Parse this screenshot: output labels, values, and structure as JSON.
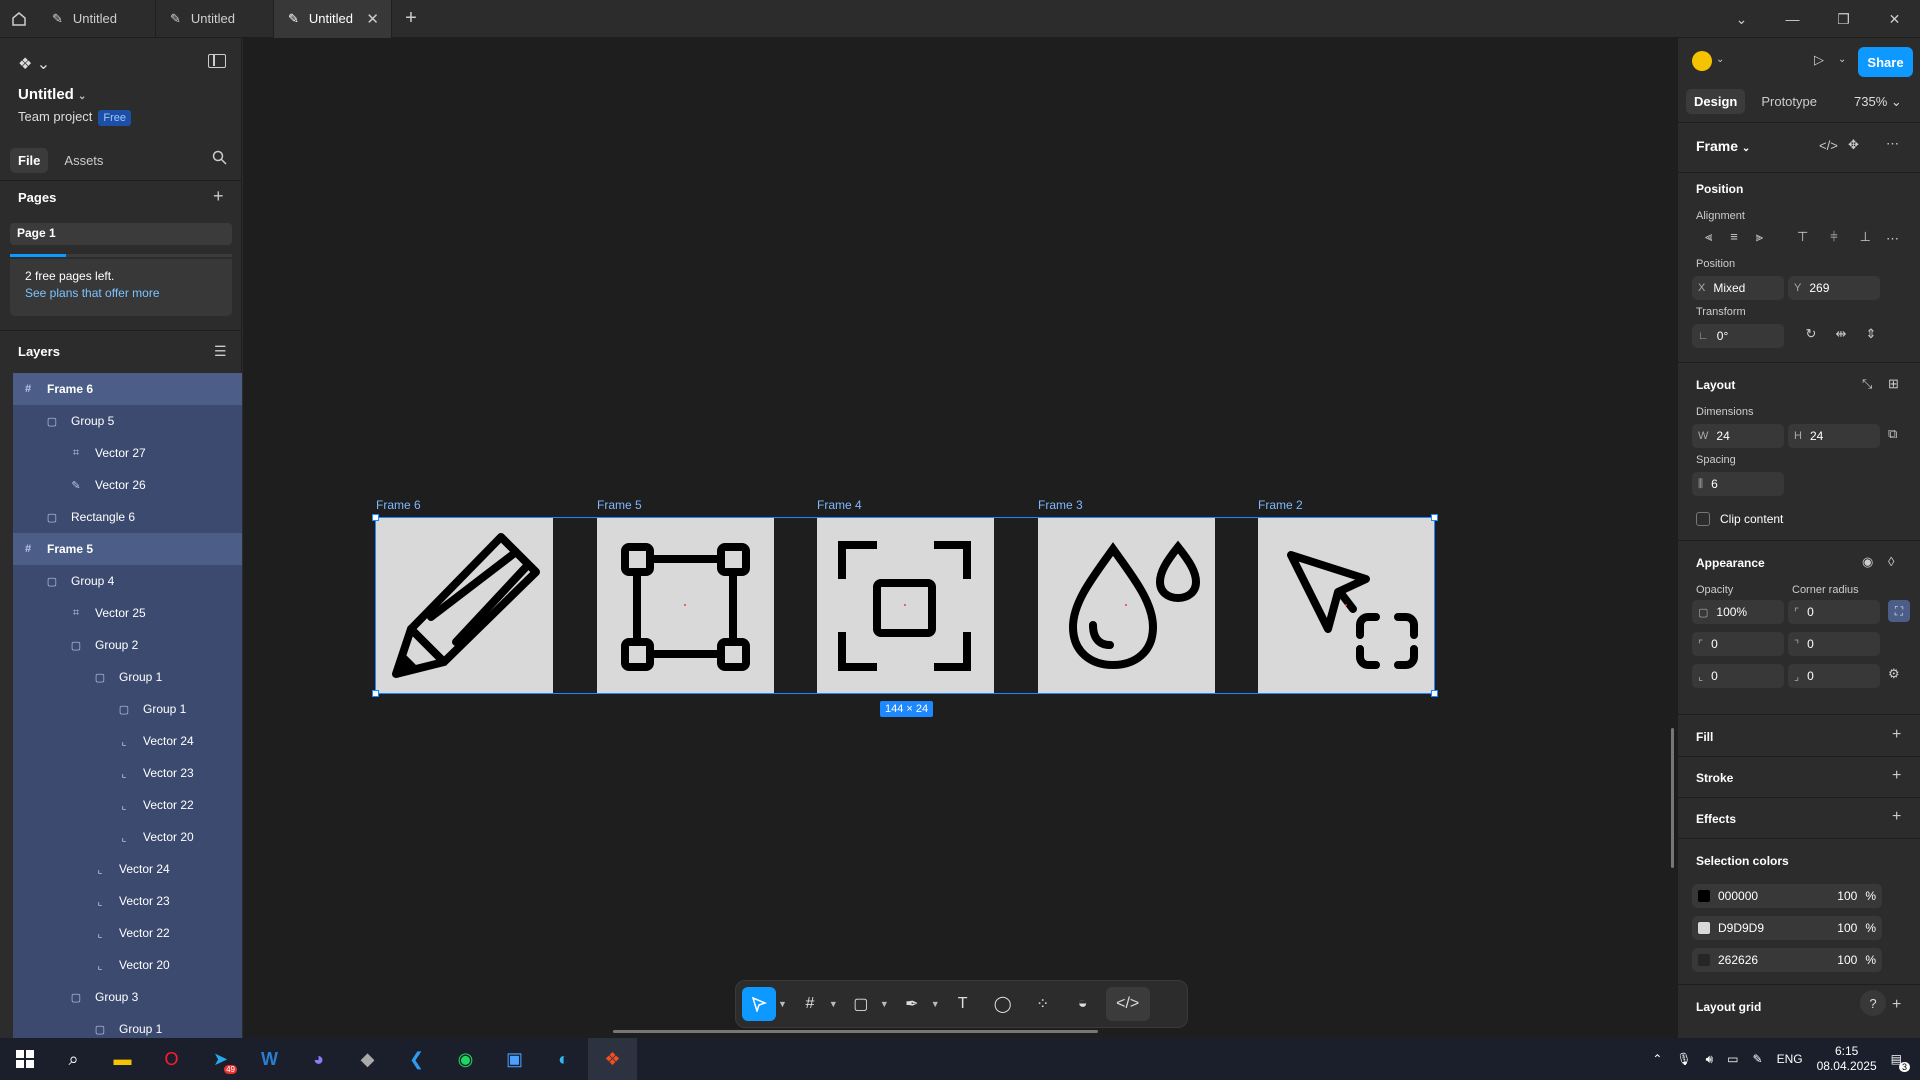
{
  "titlebar": {
    "tabs": [
      {
        "label": "Untitled",
        "active": false
      },
      {
        "label": "Untitled",
        "active": false
      },
      {
        "label": "Untitled",
        "active": true
      }
    ]
  },
  "left": {
    "project_title": "Untitled",
    "project_sub": "Team project",
    "badge": "Free",
    "tab_file": "File",
    "tab_assets": "Assets",
    "pages_header": "Pages",
    "page_name": "Page 1",
    "pages_progress": 0.25,
    "free_pages": "2 free pages left.",
    "see_plans": "See plans that offer more",
    "layers_header": "Layers",
    "layers": [
      {
        "label": "Frame 6",
        "kind": "frame",
        "depth": 0
      },
      {
        "label": "Group 5",
        "kind": "group",
        "depth": 1
      },
      {
        "label": "Vector 27",
        "kind": "vector",
        "depth": 2
      },
      {
        "label": "Vector 26",
        "kind": "pen",
        "depth": 2
      },
      {
        "label": "Rectangle 6",
        "kind": "group",
        "depth": 1
      },
      {
        "label": "Frame 5",
        "kind": "frame",
        "depth": 0
      },
      {
        "label": "Group 4",
        "kind": "group",
        "depth": 1
      },
      {
        "label": "Vector 25",
        "kind": "vector",
        "depth": 2
      },
      {
        "label": "Group 2",
        "kind": "group",
        "depth": 2
      },
      {
        "label": "Group 1",
        "kind": "group",
        "depth": 3
      },
      {
        "label": "Group 1",
        "kind": "group",
        "depth": 4
      },
      {
        "label": "Vector 24",
        "kind": "corner",
        "depth": 4
      },
      {
        "label": "Vector 23",
        "kind": "corner",
        "depth": 4
      },
      {
        "label": "Vector 22",
        "kind": "corner",
        "depth": 4
      },
      {
        "label": "Vector 20",
        "kind": "corner",
        "depth": 4
      },
      {
        "label": "Vector 24",
        "kind": "corner",
        "depth": 3
      },
      {
        "label": "Vector 23",
        "kind": "corner",
        "depth": 3
      },
      {
        "label": "Vector 22",
        "kind": "corner",
        "depth": 3
      },
      {
        "label": "Vector 20",
        "kind": "corner",
        "depth": 3
      },
      {
        "label": "Group 3",
        "kind": "group",
        "depth": 2
      },
      {
        "label": "Group 1",
        "kind": "group",
        "depth": 3
      }
    ]
  },
  "canvas": {
    "frames": [
      {
        "label": "Frame 6",
        "icon": "pencil-icon"
      },
      {
        "label": "Frame 5",
        "icon": "vector-square-icon"
      },
      {
        "label": "Frame 4",
        "icon": "focus-frame-icon"
      },
      {
        "label": "Frame 3",
        "icon": "water-drops-icon"
      },
      {
        "label": "Frame 2",
        "icon": "cursor-select-icon"
      }
    ],
    "size_badge": "144 × 24"
  },
  "right": {
    "share": "Share",
    "tab_design": "Design",
    "tab_prototype": "Prototype",
    "zoom": "735%",
    "selection_type": "Frame",
    "position_header": "Position",
    "alignment_label": "Alignment",
    "position_label": "Position",
    "x_key": "X",
    "x_val": "Mixed",
    "y_key": "Y",
    "y_val": "269",
    "transform_label": "Transform",
    "rotation": "0°",
    "layout_header": "Layout",
    "dimensions_label": "Dimensions",
    "w_key": "W",
    "w_val": "24",
    "h_key": "H",
    "h_val": "24",
    "spacing_label": "Spacing",
    "spacing_val": "6",
    "clip_content": "Clip content",
    "appearance_header": "Appearance",
    "opacity_label": "Opacity",
    "opacity_val": "100%",
    "corner_label": "Corner radius",
    "corner_val": "0",
    "corner_tl": "0",
    "corner_tr": "0",
    "corner_bl": "0",
    "corner_br": "0",
    "fill": "Fill",
    "stroke": "Stroke",
    "effects": "Effects",
    "selection_colors": "Selection colors",
    "colors": [
      {
        "hex": "000000",
        "swatch": "#000000",
        "pct": "100"
      },
      {
        "hex": "D9D9D9",
        "swatch": "#D9D9D9",
        "pct": "100"
      },
      {
        "hex": "262626",
        "swatch": "#262626",
        "pct": "100"
      }
    ],
    "pct_sign": "%",
    "layout_grid": "Layout grid"
  },
  "taskbar": {
    "lang": "ENG",
    "time": "6:15",
    "date": "08.04.2025",
    "notif": "3",
    "telegram_badge": "49"
  }
}
